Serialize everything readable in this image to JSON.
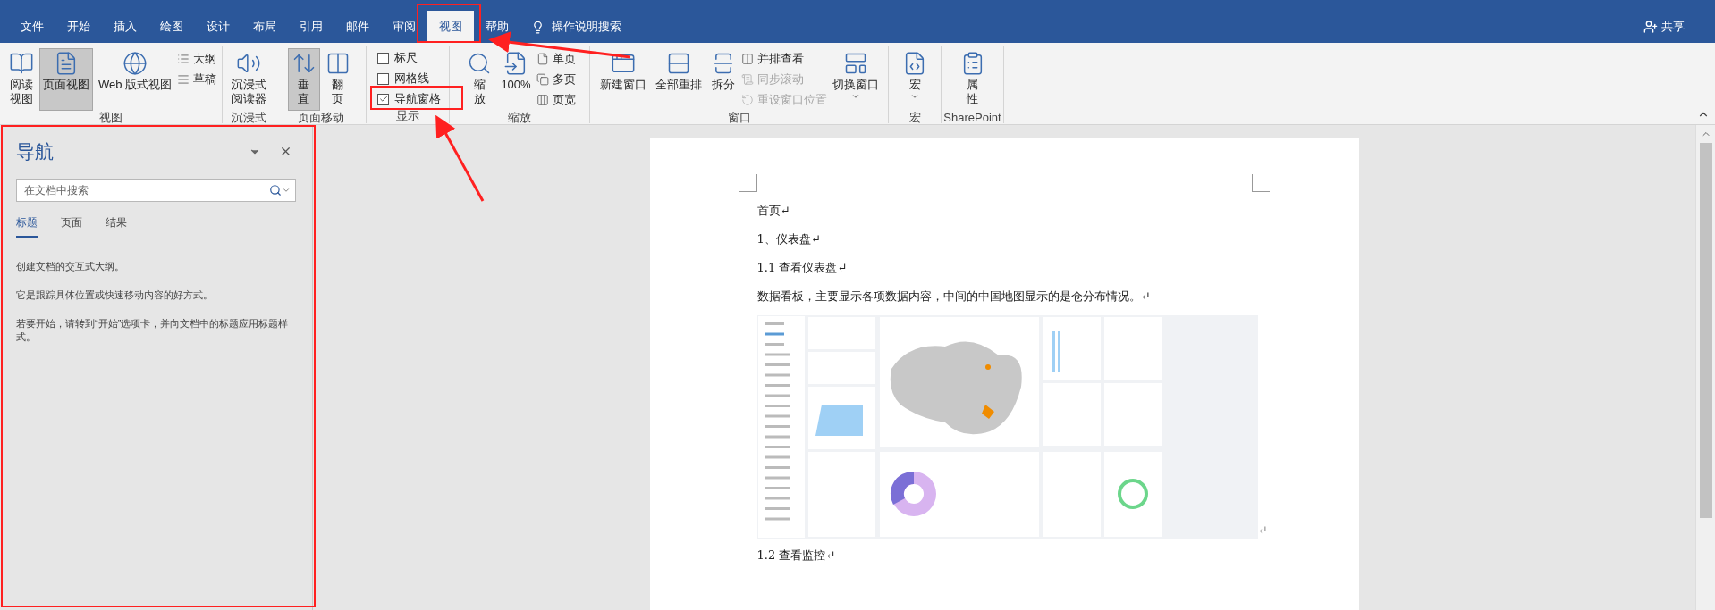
{
  "tabs": [
    {
      "label": "文件",
      "selected": false
    },
    {
      "label": "开始",
      "selected": false
    },
    {
      "label": "插入",
      "selected": false
    },
    {
      "label": "绘图",
      "selected": false
    },
    {
      "label": "设计",
      "selected": false
    },
    {
      "label": "布局",
      "selected": false
    },
    {
      "label": "引用",
      "selected": false
    },
    {
      "label": "邮件",
      "selected": false
    },
    {
      "label": "审阅",
      "selected": false
    },
    {
      "label": "视图",
      "selected": true
    },
    {
      "label": "帮助",
      "selected": false
    }
  ],
  "tell_me": "操作说明搜索",
  "share": "共享",
  "ribbon": [
    {
      "label": "视图",
      "items": [
        {
          "kind": "large",
          "lines": [
            "阅读",
            "视图"
          ],
          "selected": false
        },
        {
          "kind": "large",
          "lines": [
            "页面视图"
          ],
          "selected": true
        },
        {
          "kind": "large",
          "lines": [
            "Web 版式视图"
          ],
          "selected": false
        },
        {
          "kind": "stack",
          "items": [
            {
              "label": "大纲",
              "disabled": false
            },
            {
              "label": "草稿",
              "disabled": false
            }
          ]
        }
      ]
    },
    {
      "label": "沉浸式",
      "items": [
        {
          "kind": "large",
          "lines": [
            "沉浸式",
            "阅读器"
          ],
          "selected": false
        }
      ]
    },
    {
      "label": "页面移动",
      "items": [
        {
          "kind": "large",
          "lines": [
            "垂",
            "直"
          ],
          "selected": true
        },
        {
          "kind": "large",
          "lines": [
            "翻",
            "页"
          ],
          "selected": false
        }
      ]
    },
    {
      "label": "显示",
      "items": [
        {
          "kind": "checks",
          "items": [
            {
              "label": "标尺",
              "checked": false
            },
            {
              "label": "网格线",
              "checked": false
            },
            {
              "label": "导航窗格",
              "checked": true
            }
          ]
        }
      ]
    },
    {
      "label": "缩放",
      "items": [
        {
          "kind": "large",
          "lines": [
            "缩",
            "放"
          ],
          "selected": false
        },
        {
          "kind": "large",
          "lines": [
            "100%"
          ],
          "selected": false
        },
        {
          "kind": "stack",
          "items": [
            {
              "label": "单页",
              "disabled": false
            },
            {
              "label": "多页",
              "disabled": false
            },
            {
              "label": "页宽",
              "disabled": false
            }
          ]
        }
      ]
    },
    {
      "label": "窗口",
      "items": [
        {
          "kind": "large",
          "lines": [
            "新建窗口"
          ],
          "selected": false
        },
        {
          "kind": "large",
          "lines": [
            "全部重排"
          ],
          "selected": false
        },
        {
          "kind": "large",
          "lines": [
            "拆分"
          ],
          "selected": false
        },
        {
          "kind": "stack",
          "items": [
            {
              "label": "并排查看",
              "disabled": false
            },
            {
              "label": "同步滚动",
              "disabled": true
            },
            {
              "label": "重设窗口位置",
              "disabled": true
            }
          ]
        },
        {
          "kind": "dropdown",
          "lines": [
            "切换窗口"
          ],
          "selected": false
        }
      ]
    },
    {
      "label": "宏",
      "items": [
        {
          "kind": "dropdown",
          "lines": [
            "宏"
          ],
          "selected": false
        }
      ]
    },
    {
      "label": "SharePoint",
      "items": [
        {
          "kind": "large",
          "lines": [
            "属",
            "性"
          ],
          "selected": false
        }
      ]
    }
  ],
  "navigation": {
    "title": "导航",
    "search": {
      "placeholder": "在文档中搜索"
    },
    "tabs": [
      {
        "label": "标题",
        "selected": true
      },
      {
        "label": "页面",
        "selected": false
      },
      {
        "label": "结果",
        "selected": false
      }
    ],
    "paragraphs": [
      "创建文档的交互式大纲。",
      "它是跟踪具体位置或快速移动内容的好方式。",
      "若要开始，请转到“开始”选项卡，并向文档中的标题应用标题样式。"
    ]
  },
  "document": {
    "paragraphs_before": [
      "首页↵",
      "1、仪表盘↵",
      "1.1 查看仪表盘↵",
      "数据看板，主要显示各项数据内容，中间的中国地图显示的是仓分布情况。↵"
    ],
    "image_mark": "↵",
    "paragraphs_after": [
      "1.2 查看监控↵"
    ]
  }
}
